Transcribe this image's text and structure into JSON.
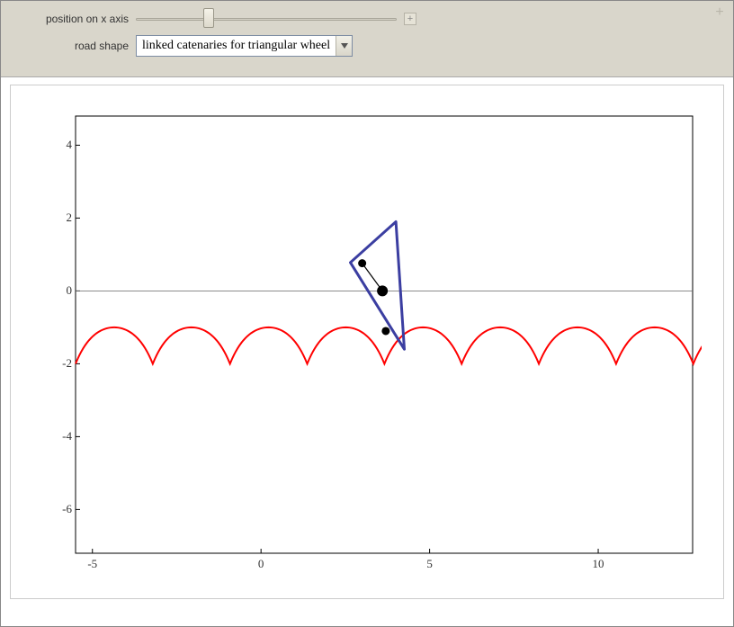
{
  "controls": {
    "position_label": "position on x axis",
    "slider_value_pct": 28,
    "road_shape_label": "road shape",
    "road_shape_selected": "linked catenaries for triangular wheel"
  },
  "chart_data": {
    "type": "line",
    "xlim": [
      -5.5,
      12.8
    ],
    "ylim": [
      -7.2,
      4.8
    ],
    "x_ticks": [
      -5,
      0,
      5,
      10
    ],
    "y_ticks": [
      -6,
      -4,
      -2,
      0,
      2,
      4
    ],
    "x_tick_labels": [
      "-5",
      "0",
      "5",
      "10"
    ],
    "y_tick_labels": [
      "-6",
      "-4",
      "-2",
      "0",
      "2",
      "4"
    ],
    "road": {
      "color": "#ff0000",
      "ymin": -2,
      "ymax": -1,
      "period": 2.29,
      "start_x": -5.5,
      "n_arches": 9
    },
    "wheel": {
      "color": "#3b3ea1",
      "vertices": [
        [
          2.65,
          0.78
        ],
        [
          4.0,
          1.9
        ],
        [
          4.25,
          -1.6
        ]
      ],
      "center": [
        3.6,
        0.0
      ],
      "contact": [
        3.7,
        -1.1
      ]
    },
    "axis_line_y": 0
  }
}
